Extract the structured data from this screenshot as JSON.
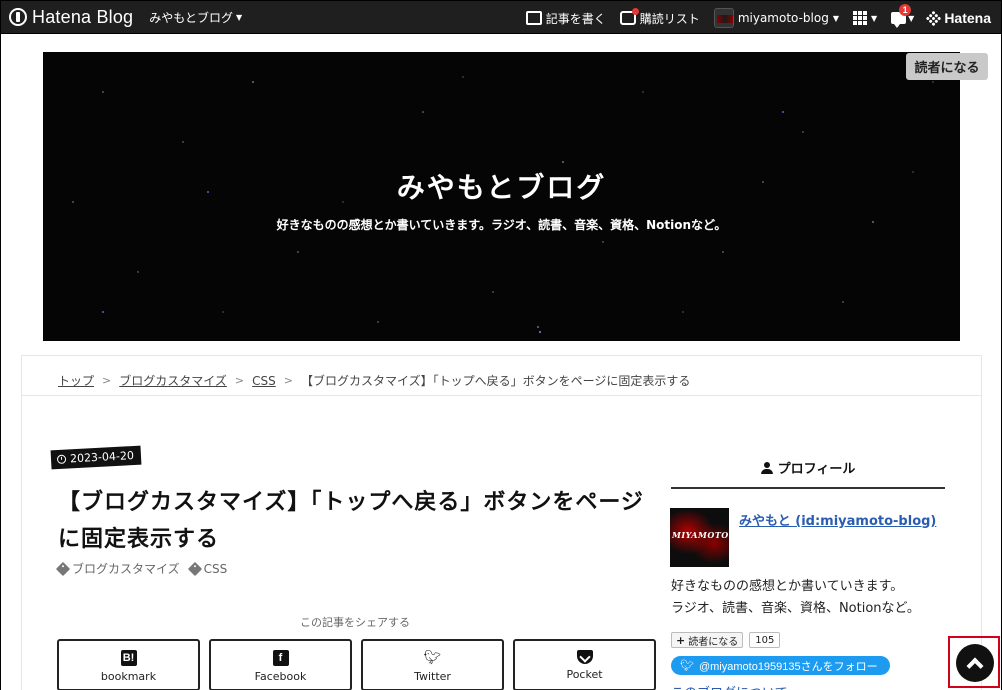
{
  "navbar": {
    "brand": "Hatena Blog",
    "blog_selector": "みやもとブログ",
    "write": "記事を書く",
    "reading_list": "購読リスト",
    "account": "miyamoto-blog",
    "notification_count": "1",
    "hatena": "Hatena"
  },
  "header": {
    "title": "みやもとブログ",
    "description": "好きなものの感想とか書いていきます。ラジオ、読書、音楽、資格、Notionなど。",
    "subscribe": "読者になる"
  },
  "breadcrumb": {
    "items": [
      "トップ",
      "ブログカスタマイズ",
      "CSS"
    ],
    "current": "【ブログカスタマイズ】「トップへ戻る」ボタンをページに固定表示する",
    "separator": ">"
  },
  "article": {
    "date": "2023-04-20",
    "title": "【ブログカスタマイズ】「トップへ戻る」ボタンをページに固定表示する",
    "categories": [
      "ブログカスタマイズ",
      "CSS"
    ],
    "share_label": "この記事をシェアする",
    "share_buttons": [
      "bookmark",
      "Facebook",
      "Twitter",
      "Pocket"
    ]
  },
  "sidebar": {
    "profile_heading": "プロフィール",
    "profile_name": "みやもと (id:miyamoto-blog)",
    "avatar_text": "MIYAMOTO",
    "description_lines": [
      "好きなものの感想とか書いていきます。",
      "ラジオ、読書、音楽、資格、Notionなど。"
    ],
    "subscribe_small": "読者になる",
    "subscriber_count": "105",
    "twitter_follow": "@miyamoto1959135さんをフォロー",
    "about_link": "このブログについて"
  },
  "colors": {
    "navbar_bg": "#1f1f1f",
    "header_bg": "#050505",
    "link": "#2a5db0",
    "twitter": "#1d9bf0",
    "highlight_outline": "#d0021b"
  },
  "icons": [
    "hatena-blog-logo-icon",
    "caret-down-icon",
    "edit-icon",
    "reading-list-icon",
    "grid-icon",
    "notification-icon",
    "hatena-dots-icon",
    "clock-icon",
    "tag-icon",
    "hatena-bookmark-icon",
    "facebook-icon",
    "twitter-icon",
    "pocket-icon",
    "person-icon",
    "chevron-up-icon"
  ]
}
